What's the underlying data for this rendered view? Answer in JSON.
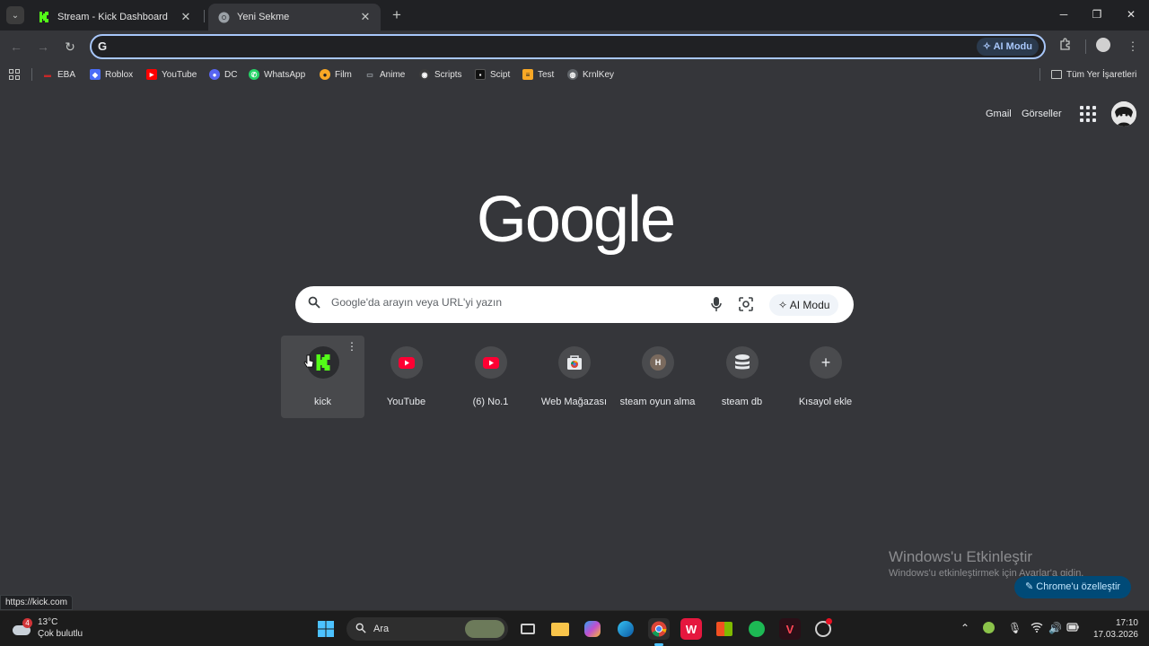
{
  "tabs": [
    {
      "title": "Stream - Kick Dashboard",
      "favicon": "kick-icon",
      "active": false
    },
    {
      "title": "Yeni Sekme",
      "favicon": "chrome-icon",
      "active": true
    }
  ],
  "window_controls": {
    "minimize": "─",
    "restore": "❐",
    "close": "✕"
  },
  "omnibox": {
    "value": "",
    "ai_mode_label": "AI Modu"
  },
  "bookmarks": [
    {
      "label": "EBA",
      "color": "#c62828"
    },
    {
      "label": "Roblox",
      "color": "#4a6cf7"
    },
    {
      "label": "YouTube",
      "color": "#ff0000"
    },
    {
      "label": "DC",
      "color": "#5865f2"
    },
    {
      "label": "WhatsApp",
      "color": "#25d366"
    },
    {
      "label": "Film",
      "color": "#f9a825"
    },
    {
      "label": "Anime",
      "color": "#5f6368"
    },
    {
      "label": "Scripts",
      "color": "#3c3c3c"
    },
    {
      "label": "Scipt",
      "color": "#111111"
    },
    {
      "label": "Test",
      "color": "#f9a825"
    },
    {
      "label": "KrnlKey",
      "color": "#5f6368"
    }
  ],
  "all_bookmarks_label": "Tüm Yer İşaretleri",
  "ntp": {
    "gmail": "Gmail",
    "images": "Görseller",
    "logo": "Google",
    "search_placeholder": "Google'da arayın veya URL'yi yazın",
    "ai_mode_label": "AI Modu",
    "shortcuts": [
      {
        "label": "kick",
        "icon": "kick-icon"
      },
      {
        "label": "YouTube",
        "icon": "youtube-icon"
      },
      {
        "label": "(6) No.1",
        "icon": "youtube-icon"
      },
      {
        "label": "Web Mağazası",
        "icon": "web-store-icon"
      },
      {
        "label": "steam oyun alma",
        "icon": "letter-h-icon",
        "letter": "H"
      },
      {
        "label": "steam db",
        "icon": "steamdb-icon"
      },
      {
        "label": "Kısayol ekle",
        "icon": "plus-icon",
        "symbol": "+"
      }
    ],
    "customize_label": "Chrome'u özelleştir"
  },
  "activation": {
    "title": "Windows'u Etkinleştir",
    "subtitle": "Windows'u etkinleştirmek için Ayarlar'a gidin."
  },
  "status_url": "https://kick.com",
  "taskbar": {
    "weather_temp": "13°C",
    "weather_desc": "Çok bulutlu",
    "weather_badge": "4",
    "search_label": "Ara",
    "time": "17:10",
    "date": "17.03.2026"
  },
  "colors": {
    "accent": "#a8c7fa",
    "kick_green": "#53fc18",
    "youtube_red": "#ff0033"
  }
}
